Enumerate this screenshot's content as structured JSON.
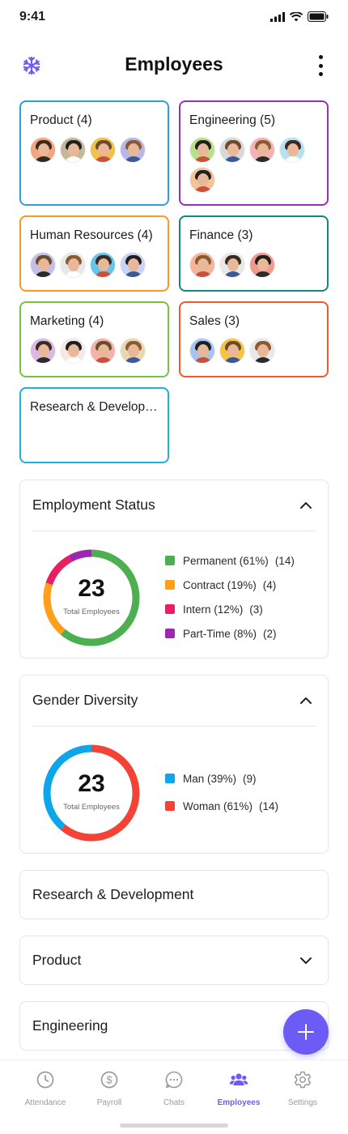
{
  "status_bar": {
    "time": "9:41"
  },
  "header": {
    "title": "Employees",
    "logo_icon": "snowflake-logo-icon",
    "menu_icon": "more-vertical-icon"
  },
  "departments": [
    {
      "title": "Product (4)",
      "border": "#2d9fd9",
      "avatars": [
        "#f2a57e",
        "#c7b79a",
        "#f0c14b",
        "#b9b6e8"
      ]
    },
    {
      "title": "Engineering (5)",
      "border": "#9b2fbb",
      "avatars": [
        "#b8e08a",
        "#d8d8d8",
        "#f2b2b6",
        "#b7e0f0",
        "#f4c39a"
      ]
    },
    {
      "title": "Human Resources (4)",
      "border": "#f59a23",
      "avatars": [
        "#c3bfe8",
        "#e8e8e8",
        "#66c4e8",
        "#c9d3f5"
      ]
    },
    {
      "title": "Finance (3)",
      "border": "#13887a",
      "avatars": [
        "#f4b69a",
        "#e8e8e8",
        "#f09a8e"
      ]
    },
    {
      "title": "Marketing (4)",
      "border": "#7ac143",
      "avatars": [
        "#d9b8e6",
        "#f5e8e6",
        "#f3b3ab",
        "#e8d8b0"
      ]
    },
    {
      "title": "Sales (3)",
      "border": "#ee5a2c",
      "avatars": [
        "#a7c3f0",
        "#f4c542",
        "#e8e8e8"
      ]
    },
    {
      "title": "Research & Development",
      "border": "#1fb2d3",
      "avatars": []
    }
  ],
  "employment_status": {
    "title": "Employment Status",
    "total": "23",
    "total_label": "Total Employees",
    "items": [
      {
        "label": "Permanent (61%)",
        "count": "(14)",
        "color": "#4caf50",
        "value": 61
      },
      {
        "label": "Contract (19%)",
        "count": "(4)",
        "color": "#ff9f1c",
        "value": 19
      },
      {
        "label": "Intern (12%)",
        "count": "(3)",
        "color": "#e91e63",
        "value": 12
      },
      {
        "label": "Part-Time (8%)",
        "count": "(2)",
        "color": "#9c27b0",
        "value": 8
      }
    ]
  },
  "gender_diversity": {
    "title": "Gender Diversity",
    "total": "23",
    "total_label": "Total Employees",
    "items": [
      {
        "label": "Man (39%)",
        "count": "(9)",
        "color": "#0ea5e9",
        "value": 39
      },
      {
        "label": "Woman (61%)",
        "count": "(14)",
        "color": "#f44336",
        "value": 61
      }
    ]
  },
  "collapsed_sections": [
    {
      "title": "Research & Development"
    },
    {
      "title": "Product"
    },
    {
      "title": "Engineering"
    }
  ],
  "fab": {
    "icon": "plus-icon"
  },
  "bottom_nav": [
    {
      "label": "Attendance",
      "icon": "clock-icon",
      "active": false
    },
    {
      "label": "Payroll",
      "icon": "dollar-icon",
      "active": false
    },
    {
      "label": "Chats",
      "icon": "chat-bubble-icon",
      "active": false
    },
    {
      "label": "Employees",
      "icon": "users-icon",
      "active": true
    },
    {
      "label": "Settings",
      "icon": "gear-icon",
      "active": false
    }
  ],
  "colors": {
    "accent": "#6c5cf5"
  }
}
